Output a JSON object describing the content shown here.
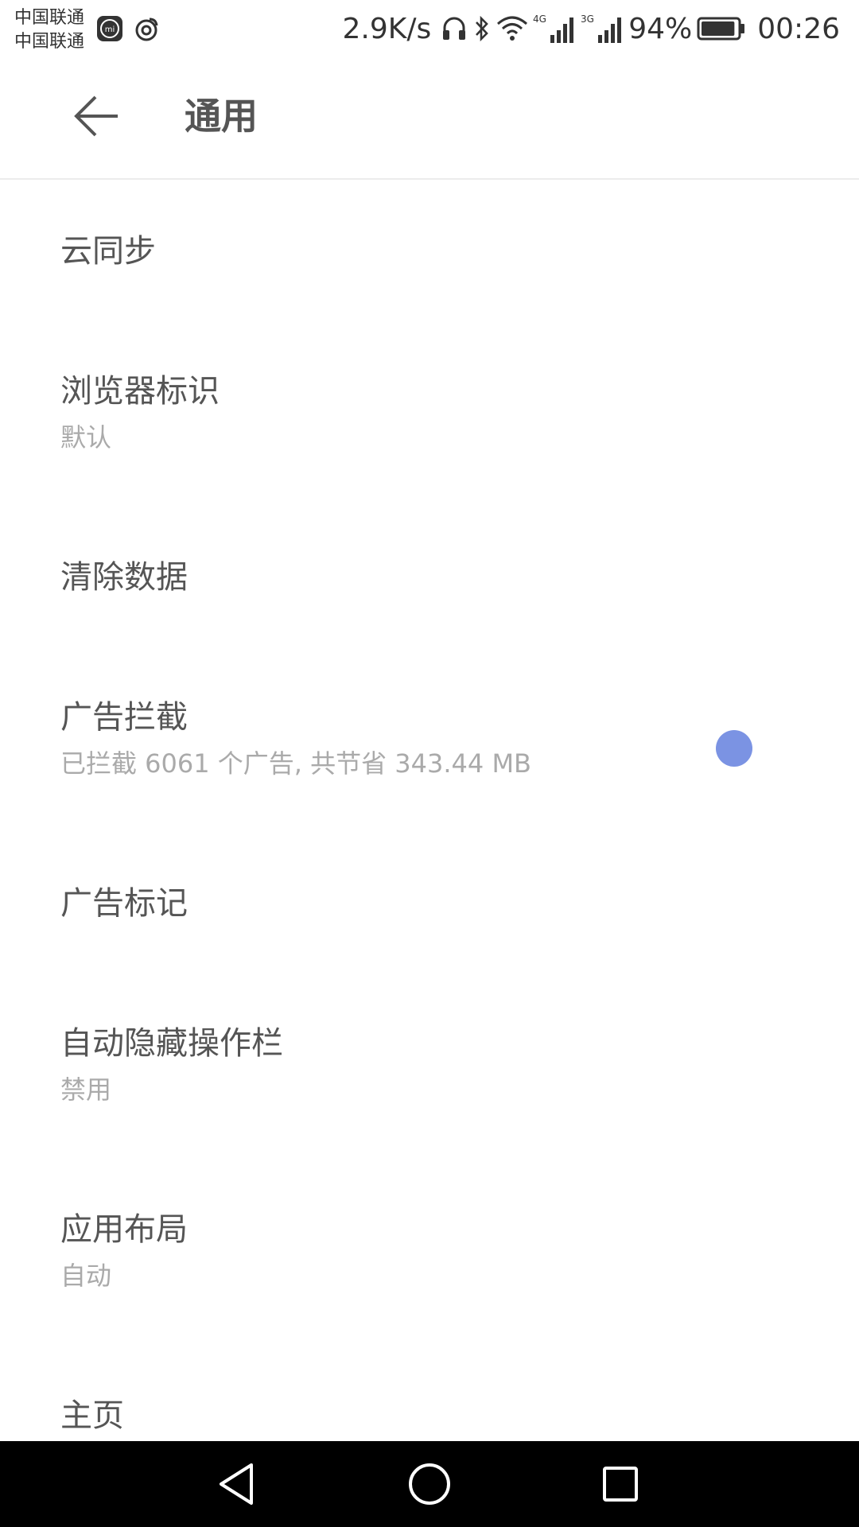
{
  "status_bar": {
    "carrier_1": "中国联通",
    "carrier_2": "中国联通",
    "net_speed": "2.9K/s",
    "signal_1_type": "4G",
    "signal_2_type": "3G",
    "battery_percent": "94%",
    "battery_level": 0.94,
    "time": "00:26",
    "icons": [
      "mi-icon",
      "weibo-icon",
      "headphones-icon",
      "bluetooth-icon",
      "wifi-icon",
      "signal-icon",
      "battery-icon"
    ]
  },
  "app_bar": {
    "back_icon": "arrow-left-icon",
    "title": "通用"
  },
  "settings": {
    "items": [
      {
        "title": "云同步",
        "subtitle": ""
      },
      {
        "title": "浏览器标识",
        "subtitle": "默认"
      },
      {
        "title": "清除数据",
        "subtitle": ""
      },
      {
        "title": "广告拦截",
        "subtitle": "已拦截 6061 个广告, 共节省 343.44 MB",
        "toggle_on": true
      },
      {
        "title": "广告标记",
        "subtitle": ""
      },
      {
        "title": "自动隐藏操作栏",
        "subtitle": "禁用"
      },
      {
        "title": "应用布局",
        "subtitle": "自动"
      },
      {
        "title": "主页",
        "subtitle": ""
      }
    ]
  },
  "nav_bar": {
    "icons": [
      "back-triangle-icon",
      "home-circle-icon",
      "recents-square-icon"
    ]
  },
  "colors": {
    "accent": "#7b93e3",
    "title_text": "#555555",
    "subtitle_text": "#aaaaaa",
    "divider": "#ececec",
    "nav_bg": "#000000"
  }
}
